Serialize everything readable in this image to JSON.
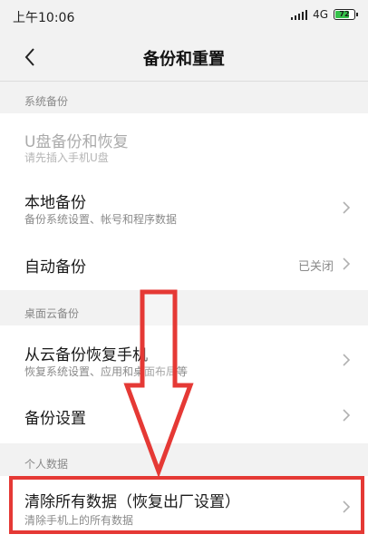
{
  "status_bar": {
    "time": "上午10:06",
    "network": "4G",
    "battery": "72"
  },
  "header": {
    "title": "备份和重置",
    "back_icon": "chevron-left-icon"
  },
  "sections": [
    {
      "header": "系统备份",
      "items": [
        {
          "title": "U盘备份和恢复",
          "subtitle": "请先插入手机U盘",
          "disabled": true
        },
        {
          "title": "本地备份",
          "subtitle": "备份系统设置、帐号和程序数据"
        },
        {
          "title": "自动备份",
          "value": "已关闭"
        }
      ]
    },
    {
      "header": "桌面云备份",
      "items": [
        {
          "title": "从云备份恢复手机",
          "subtitle": "恢复系统设置、应用和桌面布局等"
        },
        {
          "title": "备份设置"
        }
      ]
    },
    {
      "header": "个人数据",
      "items": [
        {
          "title": "清除所有数据（恢复出厂设置）",
          "subtitle": "清除手机上的所有数据"
        }
      ]
    }
  ],
  "annotation": {
    "color": "#e53935",
    "arrow": "down-arrow",
    "highlight": "factory-reset-row"
  }
}
